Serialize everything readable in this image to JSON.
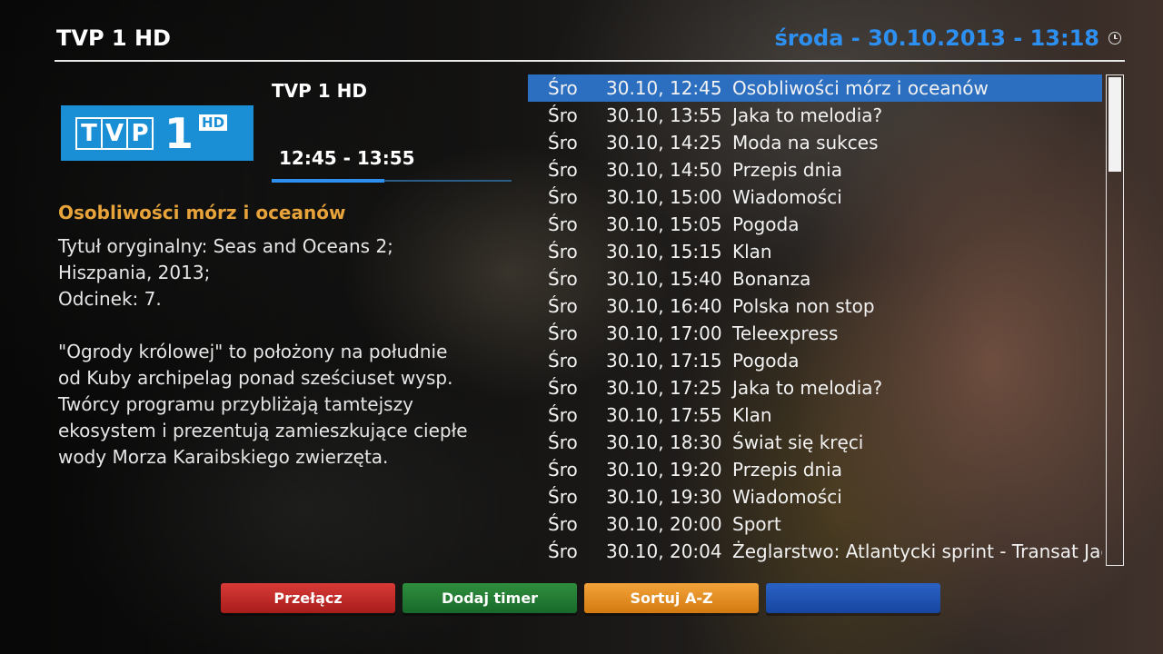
{
  "header": {
    "channel_title": "TVP 1 HD",
    "datetime": "środa - 30.10.2013 - 13:18",
    "clock_icon": "clock-icon"
  },
  "channel_logo": {
    "letters": [
      "T",
      "V",
      "P"
    ],
    "number": "1",
    "hd": "HD",
    "color": "#1a8fd6"
  },
  "event": {
    "channel": "TVP 1 HD",
    "time_range": "12:45 - 13:55",
    "progress": 0.47,
    "title": "Osobliwości mórz i oceanów",
    "description": "Tytuł oryginalny: Seas and Oceans 2;\nHiszpania, 2013;\nOdcinek: 7.\n\n\"Ogrody królowej\" to położony na południe\nod Kuby archipelag ponad sześciuset wysp.\nTwórcy programu przybliżają tamtejszy\nekosystem i prezentują zamieszkujące ciepłe\nwody Morza Karaibskiego zwierzęta."
  },
  "epg": {
    "selected_index": 0,
    "rows": [
      {
        "day": "Śro",
        "time": "30.10, 12:45",
        "title": "Osobliwości mórz i oceanów"
      },
      {
        "day": "Śro",
        "time": "30.10, 13:55",
        "title": "Jaka to melodia?"
      },
      {
        "day": "Śro",
        "time": "30.10, 14:25",
        "title": "Moda na sukces"
      },
      {
        "day": "Śro",
        "time": "30.10, 14:50",
        "title": "Przepis dnia"
      },
      {
        "day": "Śro",
        "time": "30.10, 15:00",
        "title": "Wiadomości"
      },
      {
        "day": "Śro",
        "time": "30.10, 15:05",
        "title": "Pogoda"
      },
      {
        "day": "Śro",
        "time": "30.10, 15:15",
        "title": "Klan"
      },
      {
        "day": "Śro",
        "time": "30.10, 15:40",
        "title": "Bonanza"
      },
      {
        "day": "Śro",
        "time": "30.10, 16:40",
        "title": "Polska non stop"
      },
      {
        "day": "Śro",
        "time": "30.10, 17:00",
        "title": "Teleexpress"
      },
      {
        "day": "Śro",
        "time": "30.10, 17:15",
        "title": "Pogoda"
      },
      {
        "day": "Śro",
        "time": "30.10, 17:25",
        "title": "Jaka to melodia?"
      },
      {
        "day": "Śro",
        "time": "30.10, 17:55",
        "title": "Klan"
      },
      {
        "day": "Śro",
        "time": "30.10, 18:30",
        "title": "Świat się kręci"
      },
      {
        "day": "Śro",
        "time": "30.10, 19:20",
        "title": "Przepis dnia"
      },
      {
        "day": "Śro",
        "time": "30.10, 19:30",
        "title": "Wiadomości"
      },
      {
        "day": "Śro",
        "time": "30.10, 20:00",
        "title": "Sport"
      },
      {
        "day": "Śro",
        "time": "30.10, 20:04",
        "title": "Żeglarstwo: Atlantycki sprint - Transat Jac"
      }
    ]
  },
  "buttons": {
    "red": "Przełącz",
    "green": "Dodaj timer",
    "yellow": "Sortuj A-Z",
    "blue": ""
  },
  "colors": {
    "accent_blue": "#2d8ff0",
    "title_orange": "#e8a43a",
    "selection": "#2c6ec0"
  }
}
